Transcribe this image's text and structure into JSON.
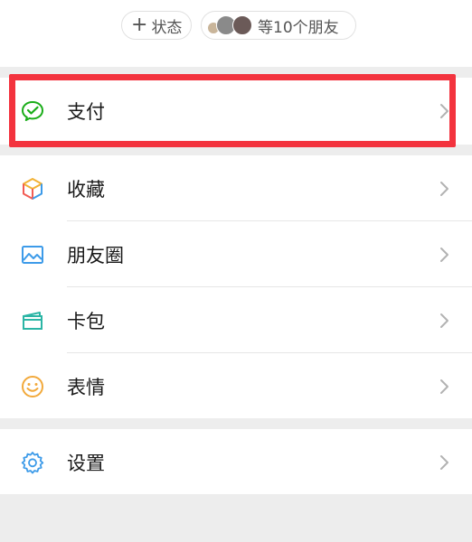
{
  "top": {
    "status_label": "状态",
    "friends_label": "等10个朋友"
  },
  "menu": {
    "pay": "支付",
    "favorites": "收藏",
    "moments": "朋友圈",
    "cards": "卡包",
    "stickers": "表情",
    "settings": "设置"
  },
  "colors": {
    "highlight": "#f3333e",
    "pay_green": "#1aad19",
    "text": "#191919",
    "background": "#ededed"
  },
  "icons": {
    "pay": "wechat-pay-icon",
    "favorites": "cube-icon",
    "moments": "image-icon",
    "cards": "card-icon",
    "stickers": "smiley-icon",
    "settings": "gear-icon",
    "chevron": "chevron-right-icon"
  }
}
